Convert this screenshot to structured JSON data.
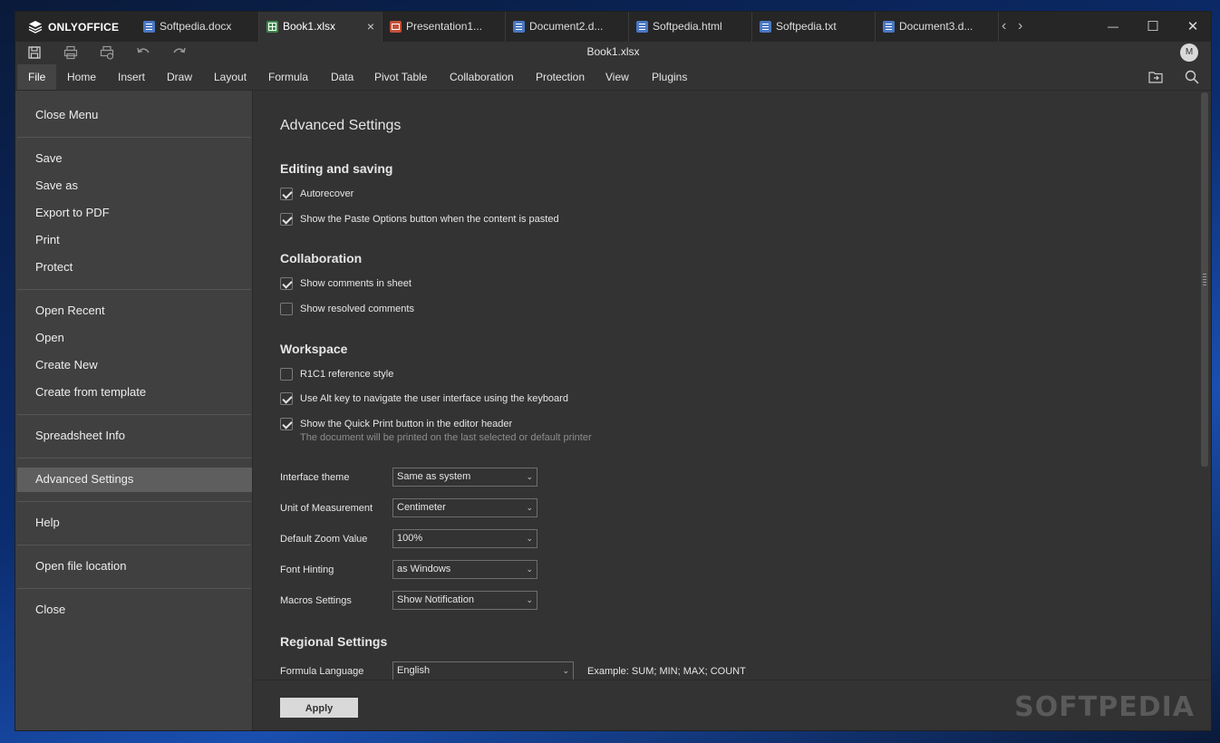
{
  "app": {
    "brand": "ONLYOFFICE",
    "document_title": "Book1.xlsx",
    "user_initial": "M"
  },
  "tabs": [
    {
      "label": "Softpedia.docx",
      "type": "doc",
      "active": false
    },
    {
      "label": "Book1.xlsx",
      "type": "xls",
      "active": true
    },
    {
      "label": "Presentation1...",
      "type": "ppt",
      "active": false
    },
    {
      "label": "Document2.d...",
      "type": "doc",
      "active": false
    },
    {
      "label": "Softpedia.html",
      "type": "doc",
      "active": false
    },
    {
      "label": "Softpedia.txt",
      "type": "doc",
      "active": false
    },
    {
      "label": "Document3.d...",
      "type": "doc",
      "active": false
    }
  ],
  "menu": [
    "File",
    "Home",
    "Insert",
    "Draw",
    "Layout",
    "Formula",
    "Data",
    "Pivot Table",
    "Collaboration",
    "Protection",
    "View",
    "Plugins"
  ],
  "file_menu": {
    "close_menu": "Close Menu",
    "save": "Save",
    "save_as": "Save as",
    "export_pdf": "Export to PDF",
    "print": "Print",
    "protect": "Protect",
    "open_recent": "Open Recent",
    "open": "Open",
    "create_new": "Create New",
    "create_template": "Create from template",
    "spreadsheet_info": "Spreadsheet Info",
    "advanced_settings": "Advanced Settings",
    "help": "Help",
    "open_location": "Open file location",
    "close": "Close"
  },
  "settings": {
    "title": "Advanced Settings",
    "editing_heading": "Editing and saving",
    "autorecover": {
      "label": "Autorecover",
      "checked": true
    },
    "paste_options": {
      "label": "Show the Paste Options button when the content is pasted",
      "checked": true
    },
    "collab_heading": "Collaboration",
    "show_comments": {
      "label": "Show comments in sheet",
      "checked": true
    },
    "show_resolved": {
      "label": "Show resolved comments",
      "checked": false
    },
    "workspace_heading": "Workspace",
    "r1c1": {
      "label": "R1C1 reference style",
      "checked": false
    },
    "alt_key": {
      "label": "Use Alt key to navigate the user interface using the keyboard",
      "checked": true
    },
    "quick_print": {
      "label": "Show the Quick Print button in the editor header",
      "note": "The document will be printed on the last selected or default printer",
      "checked": true
    },
    "interface_theme": {
      "label": "Interface theme",
      "value": "Same as system"
    },
    "unit": {
      "label": "Unit of Measurement",
      "value": "Centimeter"
    },
    "zoom": {
      "label": "Default Zoom Value",
      "value": "100%"
    },
    "font_hinting": {
      "label": "Font Hinting",
      "value": "as Windows"
    },
    "macros": {
      "label": "Macros Settings",
      "value": "Show Notification"
    },
    "regional_heading": "Regional Settings",
    "formula_language": {
      "label": "Formula Language",
      "value": "English",
      "example": "Example: SUM; MIN; MAX; COUNT"
    },
    "apply": "Apply"
  },
  "watermark": "SOFTPEDIA",
  "icons": {
    "tab_close": "×",
    "nav_left": "‹",
    "nav_right": "›",
    "minimize": "—",
    "maximize": "☐",
    "close": "✕",
    "chevron": "⌄"
  }
}
